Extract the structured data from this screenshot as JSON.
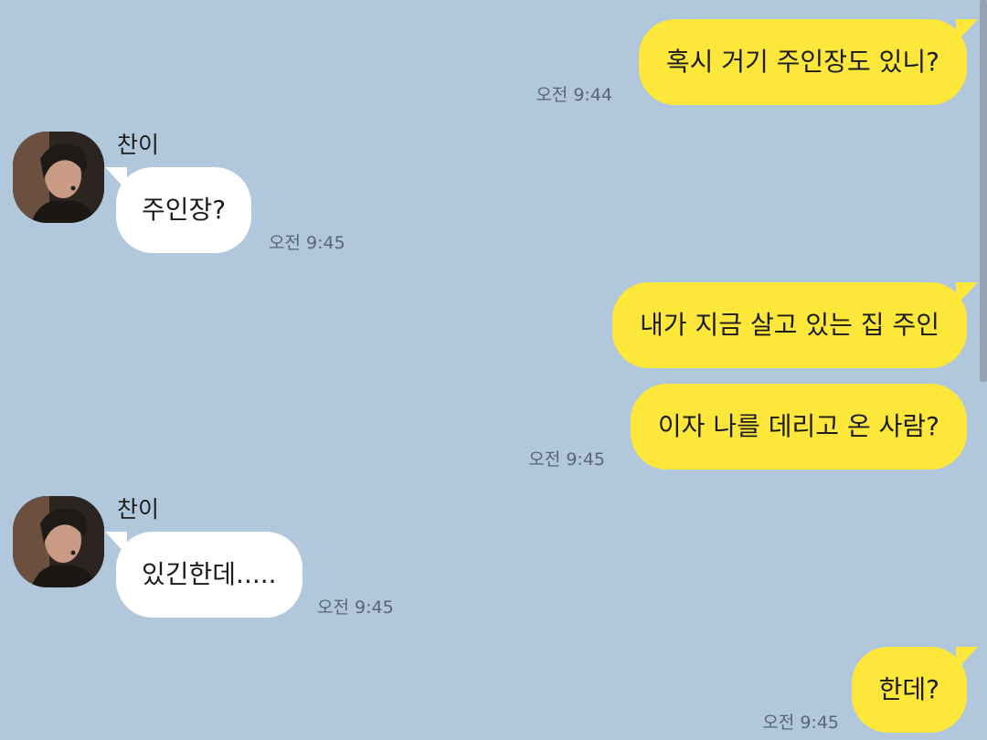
{
  "conversation": {
    "contact_name": "찬이",
    "messages": [
      {
        "sender": "me",
        "text": "혹시 거기 주인장도 있니?",
        "time": "오전 9:44"
      },
      {
        "sender": "them",
        "name": "찬이",
        "text": "주인장?",
        "time": "오전 9:45"
      },
      {
        "sender": "me",
        "text": "내가 지금 살고 있는 집 주인",
        "time": ""
      },
      {
        "sender": "me",
        "text": "이자 나를 데리고 온 사람?",
        "time": "오전 9:45"
      },
      {
        "sender": "them",
        "name": "찬이",
        "text": "있긴한데.....",
        "time": "오전 9:45"
      },
      {
        "sender": "me",
        "text": "한데?",
        "time": "오전 9:45"
      }
    ]
  },
  "colors": {
    "background": "#b1c7db",
    "my_bubble": "#fde73a",
    "their_bubble": "#ffffff"
  }
}
